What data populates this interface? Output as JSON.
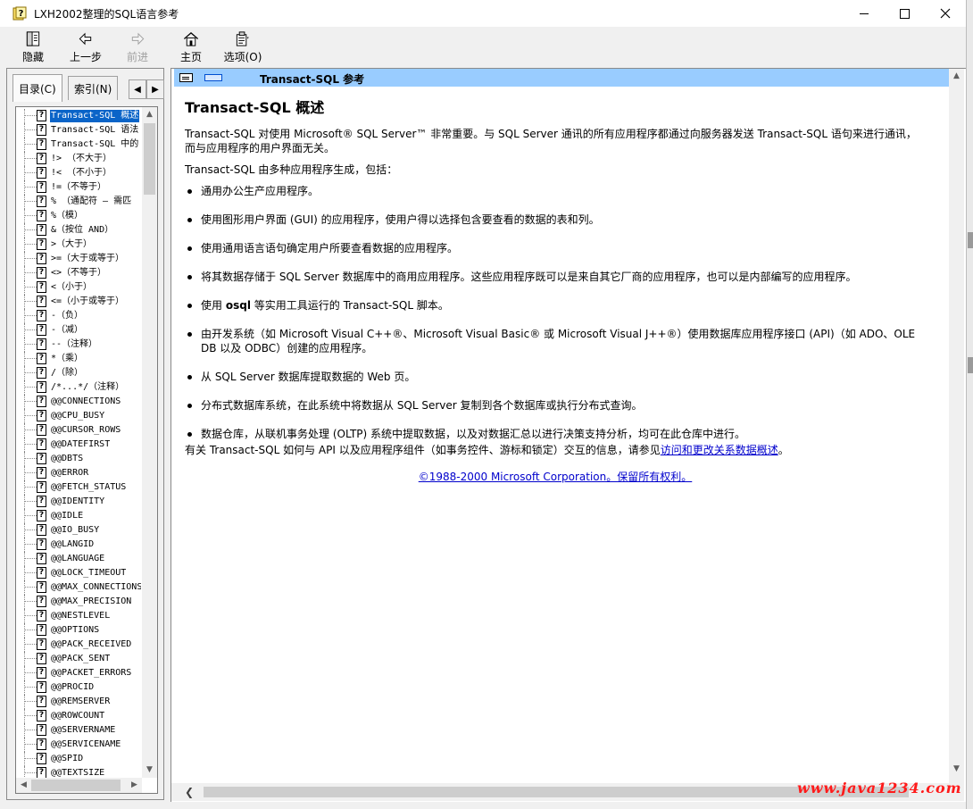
{
  "window": {
    "title": "LXH2002整理的SQL语言参考"
  },
  "toolbar": {
    "hide_label": "隐藏",
    "back_label": "上一步",
    "forward_label": "前进",
    "home_label": "主页",
    "options_label": "选项(O)"
  },
  "nav": {
    "tab_contents": "目录(C)",
    "tab_index": "索引(N)",
    "tree_items": [
      "Transact-SQL 概述",
      "Transact-SQL 语法",
      "Transact-SQL 中的",
      "!> （不大于）",
      "!< （不小于）",
      "!=（不等于）",
      "% （通配符 — 需匹",
      "%（模）",
      "&（按位 AND）",
      ">（大于）",
      ">=（大于或等于）",
      "<>（不等于）",
      "<（小于）",
      "<=（小于或等于）",
      "-（负）",
      "-（减）",
      "--（注释）",
      "*（乘）",
      "/（除）",
      "/*...*/（注释）",
      "@@CONNECTIONS",
      "@@CPU_BUSY",
      "@@CURSOR_ROWS",
      "@@DATEFIRST",
      "@@DBTS",
      "@@ERROR",
      "@@FETCH_STATUS",
      "@@IDENTITY",
      "@@IDLE",
      "@@IO_BUSY",
      "@@LANGID",
      "@@LANGUAGE",
      "@@LOCK_TIMEOUT",
      "@@MAX_CONNECTIONS",
      "@@MAX_PRECISION",
      "@@NESTLEVEL",
      "@@OPTIONS",
      "@@PACK_RECEIVED",
      "@@PACK_SENT",
      "@@PACKET_ERRORS",
      "@@PROCID",
      "@@REMSERVER",
      "@@ROWCOUNT",
      "@@SERVERNAME",
      "@@SERVICENAME",
      "@@SPID",
      "@@TEXTSIZE"
    ]
  },
  "content": {
    "banner_title": "Transact-SQL 参考",
    "heading": "Transact-SQL 概述",
    "intro": "Transact-SQL 对使用 Microsoft® SQL Server™ 非常重要。与 SQL Server 通讯的所有应用程序都通过向服务器发送 Transact-SQL 语句来进行通讯，而与应用程序的用户界面无关。",
    "lead": "Transact-SQL 由多种应用程序生成，包括：",
    "bullets": [
      "通用办公生产应用程序。",
      "使用图形用户界面 (GUI) 的应用程序，使用户得以选择包含要查看的数据的表和列。",
      "使用通用语言语句确定用户所要查看数据的应用程序。",
      "将其数据存储于 SQL Server 数据库中的商用应用程序。这些应用程序既可以是来自其它厂商的应用程序，也可以是内部编写的应用程序。",
      "等实用工具运行的 Transact-SQL 脚本。",
      "由开发系统（如 Microsoft Visual C++®、Microsoft Visual Basic® 或 Microsoft Visual J++®）使用数据库应用程序接口 (API)（如 ADO、OLE DB 以及 ODBC）创建的应用程序。",
      "从 SQL Server 数据库提取数据的 Web 页。",
      "分布式数据库系统，在此系统中将数据从 SQL Server 复制到各个数据库或执行分布式查询。",
      "数据仓库，从联机事务处理 (OLTP) 系统中提取数据，以及对数据汇总以进行决策支持分析，均可在此仓库中进行。"
    ],
    "bullet5_prefix": "使用",
    "bullet5_bold": "osql",
    "outro_text": "有关 Transact-SQL 如何与 API 以及应用程序组件（如事务控件、游标和锁定）交互的信息，请参见",
    "outro_link": "访问和更改关系数据概述",
    "outro_end": "。",
    "copyright": "©1988-2000 Microsoft Corporation。保留所有权利。"
  },
  "watermark": "www.java1234.com"
}
